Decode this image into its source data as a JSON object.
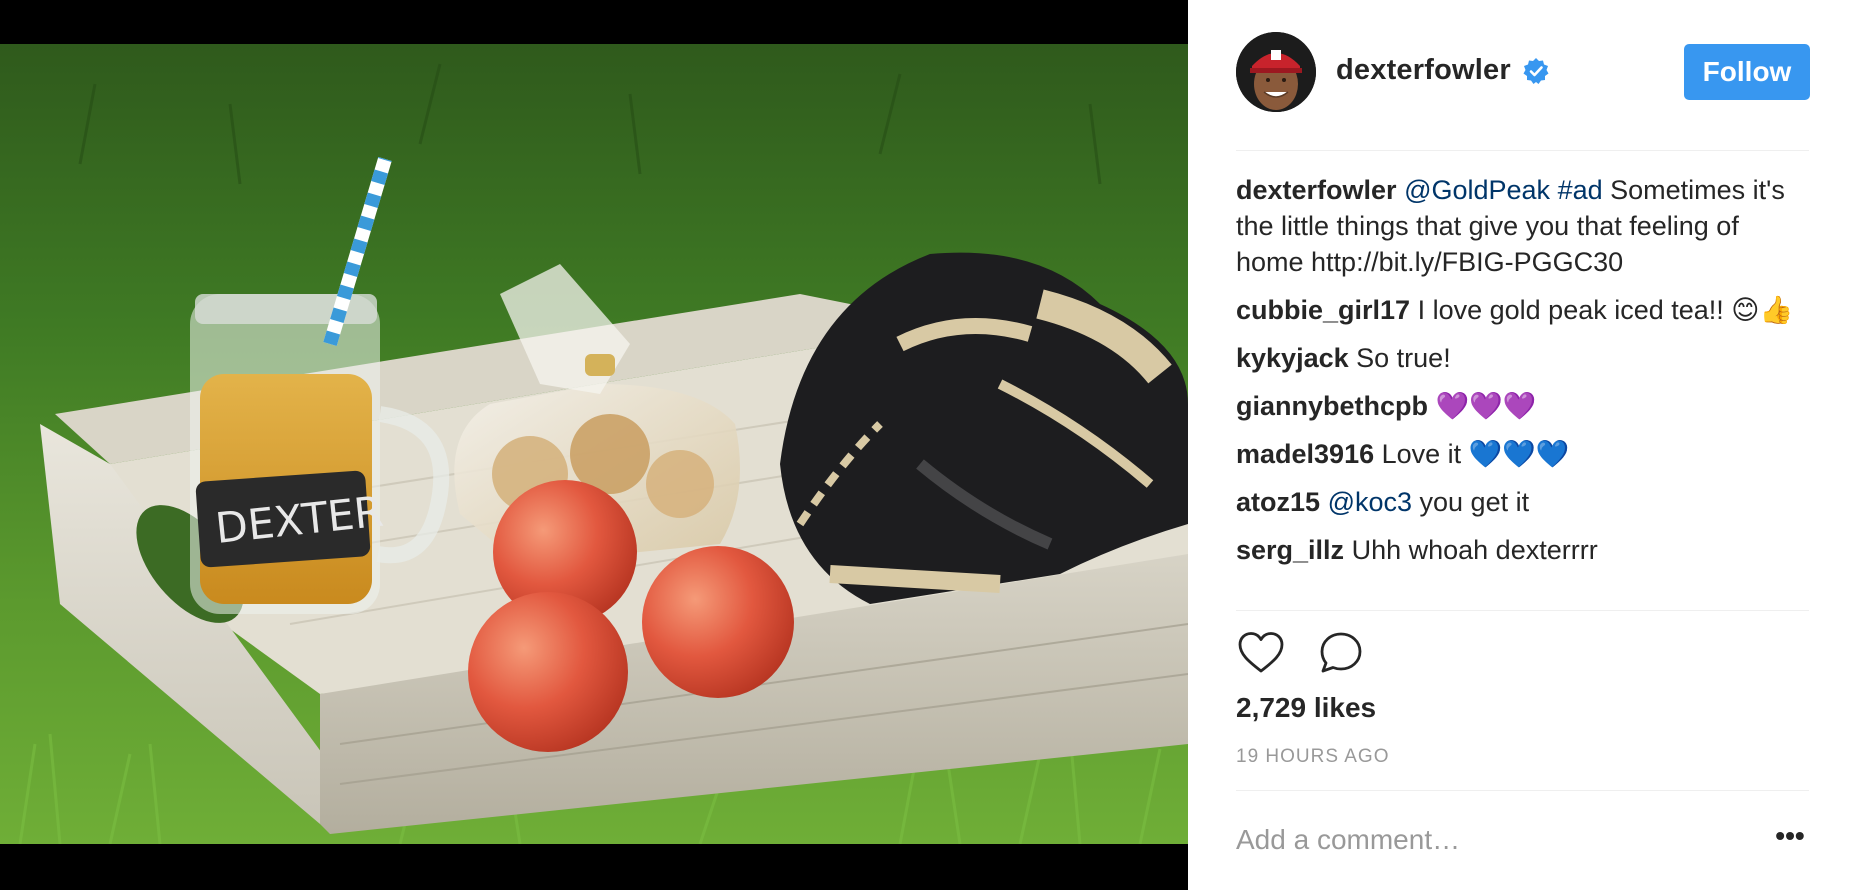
{
  "post": {
    "author": "dexterfowler",
    "follow_label": "Follow",
    "caption": {
      "user": "dexterfowler",
      "mention": "@GoldPeak",
      "tag": "#ad",
      "text": " Sometimes it's the little things that give you that feeling of home http://bit.ly/FBIG-PGGC30"
    },
    "comments": [
      {
        "user": "cubbie_girl17",
        "text": "I love gold peak iced tea!! 😊👍"
      },
      {
        "user": "kykyjack",
        "text": "So true!"
      },
      {
        "user": "giannybethcpb",
        "text": "💜💜💜"
      },
      {
        "user": "madel3916",
        "text": "Love it 💙💙💙"
      },
      {
        "user": "atoz15",
        "mention": "@koc3",
        "text": " you get it"
      },
      {
        "user": "serg_illz",
        "text": "Uhh whoah dexterrrr"
      }
    ],
    "likes": "2,729 likes",
    "time": "19 HOURS AGO",
    "comment_placeholder": "Add a comment…",
    "more_label": "•••"
  },
  "icons": {
    "verified": "verified-badge-icon",
    "like": "heart-icon",
    "comment": "comment-bubble-icon",
    "more": "more-options-icon"
  },
  "colors": {
    "follow_button": "#3897f0",
    "verified": "#3897f0",
    "mention": "#003569",
    "muted": "#999999"
  }
}
